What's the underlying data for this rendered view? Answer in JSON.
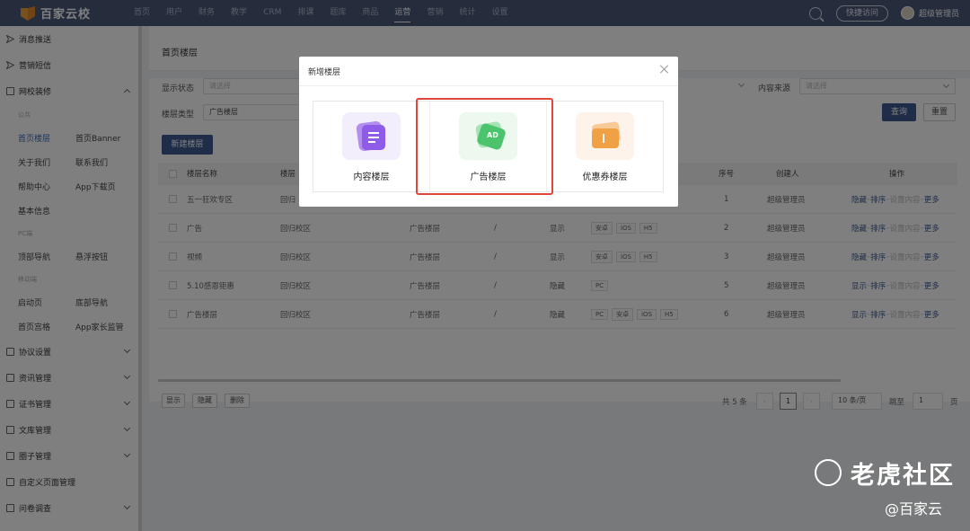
{
  "topbar": {
    "brand": "百家云校",
    "nav": [
      "首页",
      "用户",
      "财务",
      "教学",
      "CRM",
      "排课",
      "题库",
      "商品",
      "运营",
      "营销",
      "统计",
      "设置"
    ],
    "active_nav": "运营",
    "quick_access": "快捷访问",
    "user_name": "超级管理员"
  },
  "sidebar": {
    "top_items": [
      {
        "label": "消息推送",
        "icon": "send-icon"
      },
      {
        "label": "营销短信",
        "icon": "send-icon"
      },
      {
        "label": "网校装修",
        "icon": "monitor-icon",
        "expanded": true
      }
    ],
    "group_public": "公共",
    "public_rows": [
      [
        "首页楼层",
        "首页Banner"
      ],
      [
        "关于我们",
        "联系我们"
      ],
      [
        "帮助中心",
        "App下载页"
      ],
      [
        "基本信息",
        ""
      ]
    ],
    "group_pc": "PC端",
    "pc_rows": [
      [
        "顶部导航",
        "悬浮按钮"
      ]
    ],
    "group_mobile": "移动端",
    "mobile_rows": [
      [
        "启动页",
        "底部导航"
      ],
      [
        "首页宫格",
        "App家长监管"
      ]
    ],
    "bottom_items": [
      {
        "label": "协议设置",
        "arrow": true
      },
      {
        "label": "资讯管理",
        "arrow": true
      },
      {
        "label": "证书管理",
        "arrow": true
      },
      {
        "label": "文库管理",
        "arrow": true
      },
      {
        "label": "圈子管理",
        "arrow": true
      },
      {
        "label": "自定义页面管理",
        "arrow": false
      },
      {
        "label": "问卷调查",
        "arrow": true
      }
    ]
  },
  "page": {
    "title": "首页楼层",
    "filters": {
      "status_label": "显示状态",
      "status_placeholder": "请选择",
      "type_label": "楼层类型",
      "type_value": "广告楼层",
      "source_label": "内容来源",
      "source_placeholder": "请选择"
    },
    "query_button": "查询",
    "reset_button": "重置",
    "new_button": "新建楼层",
    "table": {
      "headers": [
        "楼层名称",
        "楼层",
        "序号",
        "创建人",
        "操作"
      ],
      "rows": [
        {
          "name": "五一狂欢专区",
          "campus": "回归",
          "type": "",
          "sep": "",
          "status": "",
          "tags": [],
          "order": "1",
          "creator": "超级管理员",
          "toggle": "隐藏"
        },
        {
          "name": "广告",
          "campus": "回归校区",
          "type": "广告楼层",
          "sep": "/",
          "status": "显示",
          "tags": [
            "安卓",
            "iOS",
            "H5"
          ],
          "order": "2",
          "creator": "超级管理员",
          "toggle": "隐藏"
        },
        {
          "name": "视频",
          "campus": "回归校区",
          "type": "广告楼层",
          "sep": "/",
          "status": "显示",
          "tags": [
            "安卓",
            "iOS",
            "H5"
          ],
          "order": "3",
          "creator": "超级管理员",
          "toggle": "隐藏"
        },
        {
          "name": "5.10感恩钜惠",
          "campus": "回归校区",
          "type": "广告楼层",
          "sep": "/",
          "status": "隐藏",
          "tags": [
            "PC"
          ],
          "order": "5",
          "creator": "超级管理员",
          "toggle": "显示"
        },
        {
          "name": "广告楼层",
          "campus": "回归校区",
          "type": "广告楼层",
          "sep": "/",
          "status": "隐藏",
          "tags": [
            "PC",
            "安卓",
            "iOS",
            "H5"
          ],
          "order": "6",
          "creator": "超级管理员",
          "toggle": "显示"
        }
      ],
      "ops": {
        "sort": "排序",
        "set_content": "设置内容",
        "more": "更多",
        "dash": "–"
      }
    },
    "bulk": [
      "显示",
      "隐藏",
      "删除"
    ],
    "pager": {
      "total": "共 5 条",
      "current": "1",
      "page_size": "10 条/页",
      "goto_label": "跳至",
      "goto_value": "1",
      "goto_suffix": "页"
    }
  },
  "modal": {
    "title": "新增楼层",
    "cards": [
      {
        "label": "内容楼层",
        "icon": "content-floor-icon",
        "color": "#8e5ce8",
        "bg": "#f3eefc"
      },
      {
        "label": "广告楼层",
        "icon": "ad-floor-icon",
        "color": "#4cc46e",
        "bg": "#edf8ef",
        "icon_text": "AD"
      },
      {
        "label": "优惠券楼层",
        "icon": "coupon-floor-icon",
        "color": "#f0a045",
        "bg": "#fdf3ea"
      }
    ],
    "selected": "广告楼层"
  },
  "watermark": {
    "text": "老虎社区",
    "sub": "@百家云"
  }
}
